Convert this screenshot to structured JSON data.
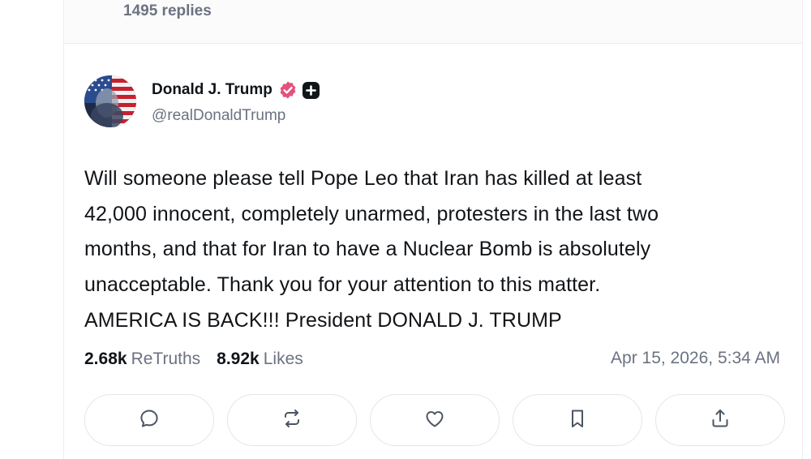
{
  "previous_post": {
    "replies_text": "1495 replies"
  },
  "post": {
    "author": {
      "display_name": "Donald J. Trump",
      "handle": "@realDonaldTrump",
      "verified_color": "#e3527e"
    },
    "text_lines": [
      "Will someone please tell Pope Leo that Iran has killed at least",
      "42,000 innocent, completely unarmed, protesters in the last two",
      "months, and that for Iran to have a Nuclear Bomb is absolutely",
      "unacceptable. Thank you for your attention to this matter.",
      "AMERICA IS BACK!!! President DONALD J. TRUMP"
    ],
    "stats": {
      "retruths_count": "2.68k",
      "retruths_label": "ReTruths",
      "likes_count": "8.92k",
      "likes_label": "Likes"
    },
    "timestamp": "Apr 15, 2026, 5:34 AM"
  },
  "actions": [
    {
      "name": "reply",
      "icon": "comment-icon"
    },
    {
      "name": "retruth",
      "icon": "repost-icon"
    },
    {
      "name": "like",
      "icon": "heart-icon"
    },
    {
      "name": "bookmark",
      "icon": "bookmark-icon"
    },
    {
      "name": "share",
      "icon": "share-icon"
    }
  ],
  "colors": {
    "muted_text": "#6b7280",
    "border": "#e4e6ea",
    "icon": "#4b5563"
  }
}
